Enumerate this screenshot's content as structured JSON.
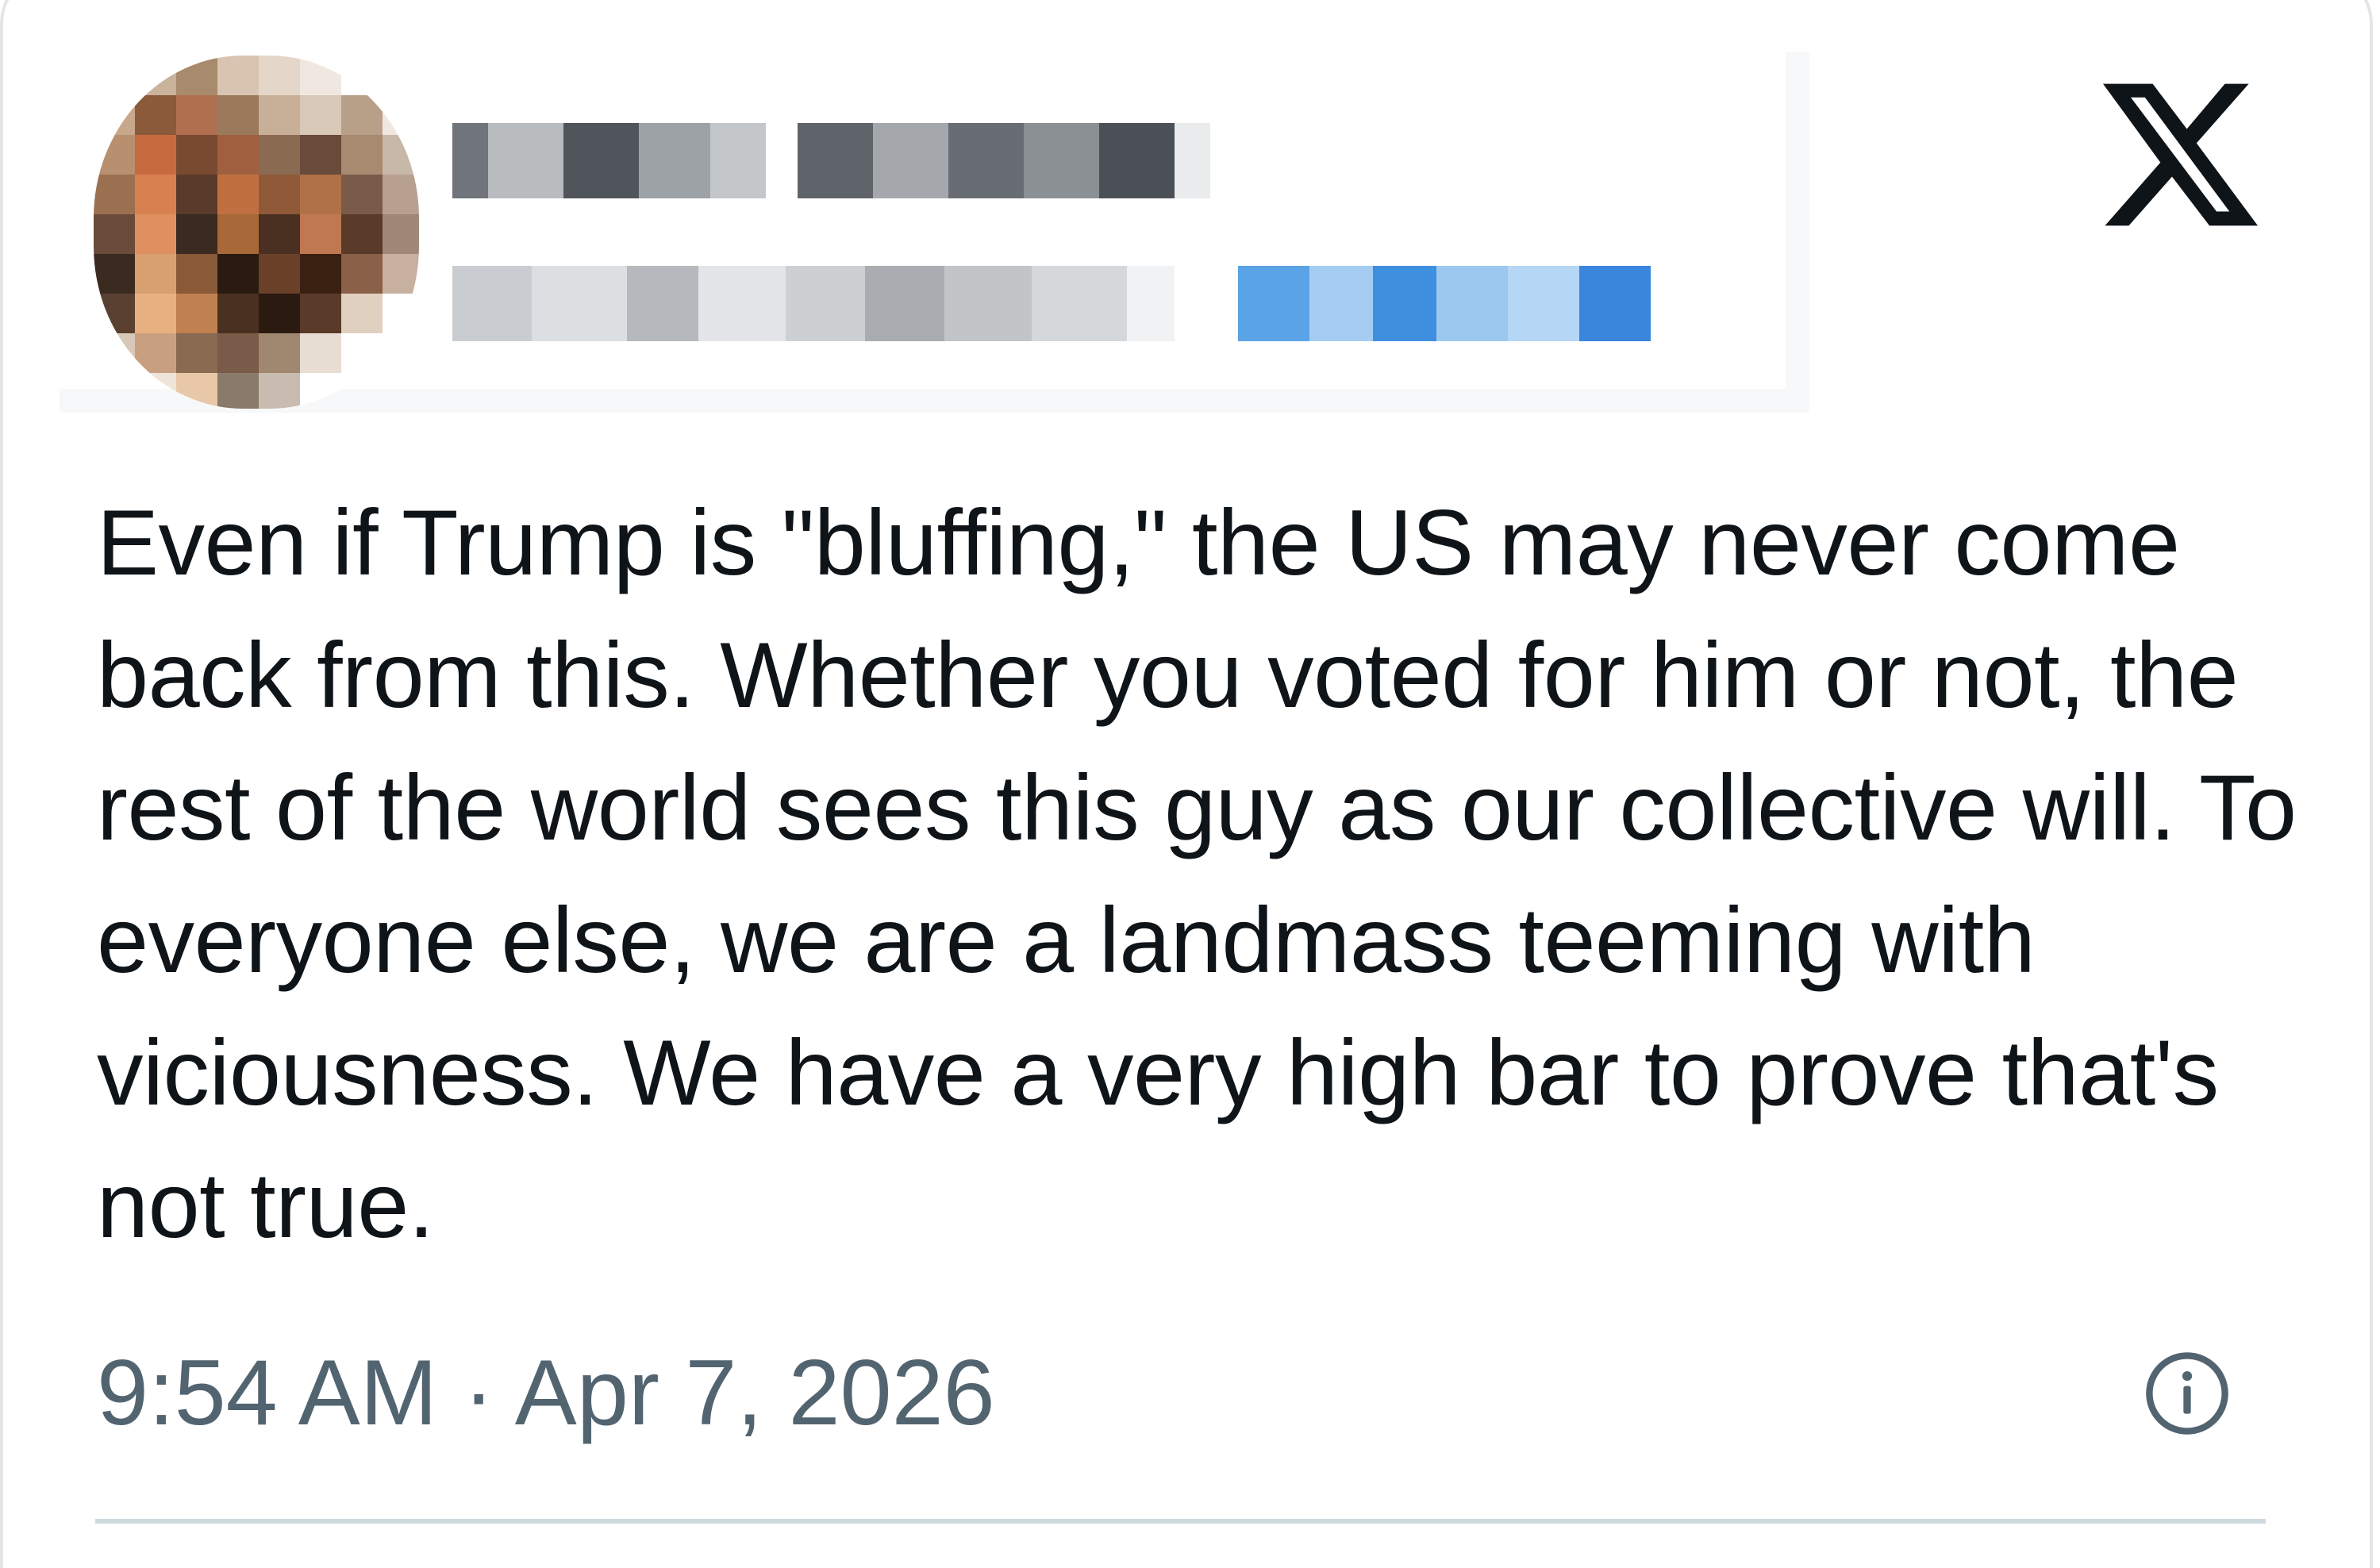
{
  "tweet": {
    "text": "Even if Trump is \"bluffing,\" the US may never come back from this. Whether you voted for him or not, the rest of the world sees this guy as our collective will. To everyone else, we are a landmass teeming with viciousness. We have a very high bar to prove that's not true.",
    "timestamp": "9:54 AM · Apr 7, 2026"
  },
  "header": {
    "author_name_obscured": true,
    "author_handle_obscured": true,
    "platform_logo_icon": "x-logo-icon"
  },
  "footer": {
    "info_icon": "info-icon"
  },
  "colors": {
    "text": "#0f1419",
    "secondary_text": "#536471",
    "border": "#e3e6e9",
    "divider": "#cfd9de",
    "follow_blue": "#1d9bf0"
  }
}
